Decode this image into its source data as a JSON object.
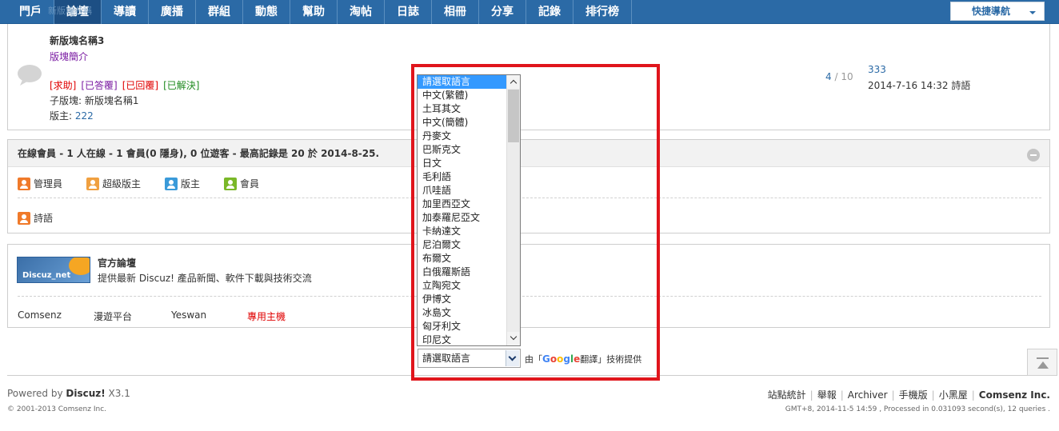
{
  "nav": {
    "items": [
      "門戶",
      "論壇",
      "導讀",
      "廣播",
      "群組",
      "動態",
      "幫助",
      "淘帖",
      "日誌",
      "相冊",
      "分享",
      "記錄",
      "排行榜"
    ],
    "ghost_text": "新版塊名稱",
    "quick_nav": "快捷導航"
  },
  "forum": {
    "name": "新版塊名稱3",
    "description": "版塊簡介",
    "tags": [
      "[求助]",
      "[已答覆]",
      "[已回覆]",
      "[已解決]"
    ],
    "sub_forum": "子版塊: 新版塊名稱1",
    "moderator_label": "版主:",
    "moderator_name": "222",
    "threads": "4",
    "posts": "10",
    "stats_sep": "/",
    "last_post_title": "333",
    "last_post_meta": "2014-7-16 14:32 詩語"
  },
  "online": {
    "title": "在線會員",
    "summary": " - 1 人在線 - 1 會員(0 隱身), 0 位遊客 - 最高記錄是 20 於 2014-8-25.",
    "legend": [
      "管理員",
      "超級版主",
      "版主",
      "會員"
    ],
    "member": "詩語"
  },
  "links": {
    "logo_text": "Discuz_net",
    "official_title": "官方論壇",
    "official_desc": "提供最新 Discuz! 產品新聞、軟件下載與技術交流",
    "partners": [
      "Comsenz",
      "漫遊平台",
      "Yeswan",
      "專用主機"
    ]
  },
  "translator": {
    "languages": [
      "請選取語言",
      "中文(繁體)",
      "土耳其文",
      "中文(簡體)",
      "丹麥文",
      "巴斯克文",
      "日文",
      "毛利語",
      "爪哇語",
      "加里西亞文",
      "加泰羅尼亞文",
      "卡納達文",
      "尼泊爾文",
      "布爾文",
      "白俄羅斯語",
      "立陶宛文",
      "伊博文",
      "冰島文",
      "匈牙利文",
      "印尼文"
    ],
    "select_value": "請選取語言",
    "credit_prefix": "由「",
    "credit_suffix": "翻譯」技術提供",
    "google": [
      "G",
      "o",
      "o",
      "g",
      "l",
      "e"
    ]
  },
  "footer": {
    "powered_prefix": "Powered by ",
    "powered_brand": "Discuz!",
    "powered_version": " X3.1",
    "copyright": "© 2001-2013 Comsenz Inc.",
    "links": [
      "站點統計",
      "舉報",
      "Archiver",
      "手機版",
      "小黑屋"
    ],
    "brand": "Comsenz Inc.",
    "meta": "GMT+8, 2014-11-5 14:59 , Processed in 0.031093 second(s), 12 queries ."
  },
  "colors": {
    "nav_bg": "#2b6aa6",
    "highlight": "#e0151c",
    "link": "#2b6aa6",
    "admin_icon": "#f07a2a",
    "supermod_icon": "#f0a040",
    "mod_icon": "#3a9ad9",
    "member_icon": "#7ab828"
  }
}
